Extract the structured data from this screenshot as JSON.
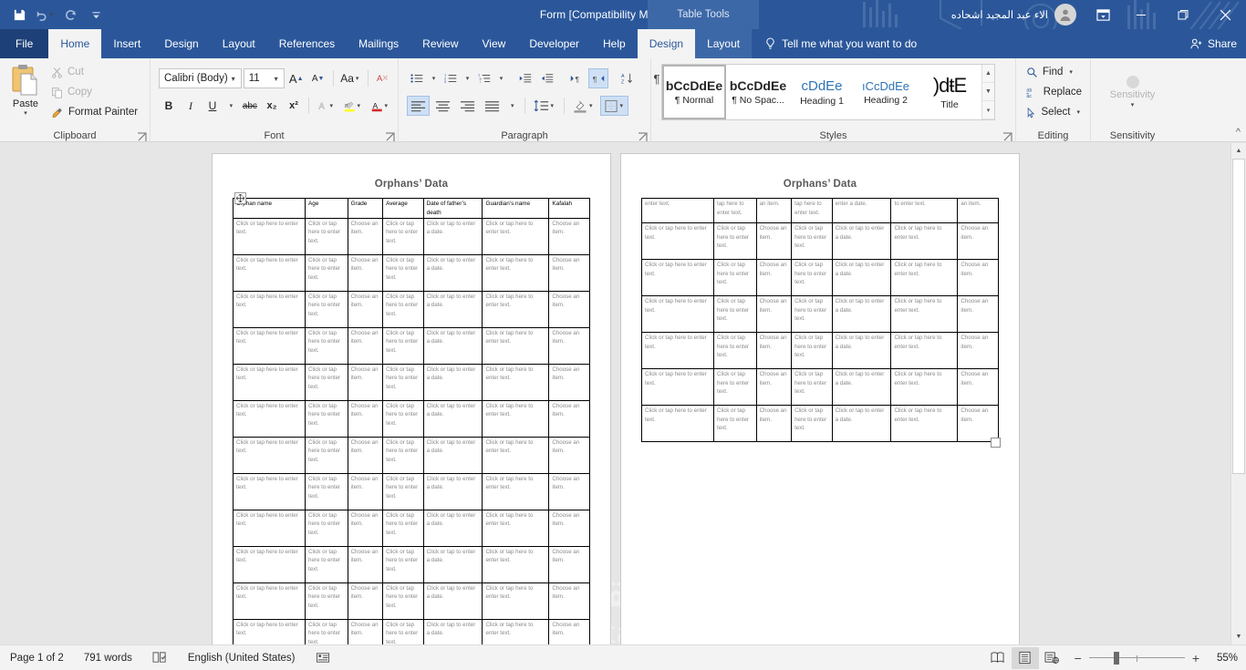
{
  "titlebar": {
    "doc_title": "Form [Compatibility Mode]  -  Word",
    "contextual_tools": "Table Tools",
    "account_name": "الاء عبد المجيد اشحاده",
    "qat": [
      {
        "name": "save-icon",
        "label": "Save"
      },
      {
        "name": "undo-icon",
        "label": "Undo"
      },
      {
        "name": "redo-icon",
        "label": "Redo"
      },
      {
        "name": "customize-qat-icon",
        "label": "Customize Quick Access Toolbar"
      }
    ],
    "window_buttons": [
      {
        "name": "ribbon-display-options-button",
        "label": "Ribbon Display Options"
      },
      {
        "name": "minimize-button",
        "label": "Minimize"
      },
      {
        "name": "restore-button",
        "label": "Restore Down"
      },
      {
        "name": "close-button",
        "label": "Close"
      }
    ]
  },
  "tabs": {
    "file": "File",
    "items": [
      "Home",
      "Insert",
      "Design",
      "Layout",
      "References",
      "Mailings",
      "Review",
      "View",
      "Developer",
      "Help"
    ],
    "active": "Home",
    "table_tools": [
      "Design",
      "Layout"
    ],
    "table_tools_active": "Design",
    "tellme": "Tell me what you want to do",
    "share": "Share"
  },
  "ribbon": {
    "clipboard": {
      "group_label": "Clipboard",
      "paste": "Paste",
      "cut": "Cut",
      "copy": "Copy",
      "format_painter": "Format Painter"
    },
    "font": {
      "group_label": "Font",
      "font_name": "Calibri (Body)",
      "font_size": "11",
      "grow_font": "A",
      "shrink_font": "A",
      "change_case": "Aa",
      "clear_formatting": "Clear All Formatting",
      "bold": "B",
      "italic": "I",
      "underline": "U",
      "strikethrough": "abc",
      "subscript": "x₂",
      "superscript": "x²",
      "text_effects": "A",
      "highlight": "ab",
      "font_color": "A"
    },
    "paragraph": {
      "group_label": "Paragraph"
    },
    "styles": {
      "group_label": "Styles",
      "items": [
        {
          "preview": "bCcDdEe",
          "name": "¶ Normal",
          "kind": "norm",
          "selected": true
        },
        {
          "preview": "bCcDdEe",
          "name": "¶ No Spac...",
          "kind": "norm",
          "selected": false
        },
        {
          "preview": "cDdEe",
          "name": "Heading 1",
          "kind": "h1",
          "selected": false
        },
        {
          "preview": "ıCcDdEe",
          "name": "Heading 2",
          "kind": "h2",
          "selected": false
        },
        {
          "preview": ")dŧE",
          "name": "Title",
          "kind": "title",
          "selected": false
        }
      ]
    },
    "editing": {
      "group_label": "Editing",
      "find": "Find",
      "replace": "Replace",
      "select": "Select"
    },
    "sensitivity": {
      "group_label": "Sensitivity",
      "button": "Sensitivity"
    }
  },
  "document": {
    "page_title": "Orphans’ Data",
    "columns": [
      "Orphan name",
      "Age",
      "Grade",
      "Average",
      "Date of father’s death",
      "Guardian’s name",
      "Kafalah"
    ],
    "cell_placeholders": {
      "name": "Click or tap here to enter text.",
      "age": "Click or tap here to enter text.",
      "grade": "Choose an item.",
      "average": "Click or tap here to enter text.",
      "date_of_death": "Click or tap to enter a date.",
      "guardian": "Click or tap here to enter text.",
      "kafalah": "Choose an item."
    },
    "page2_continuation": {
      "name": "enter text.",
      "age": "tap here to enter text.",
      "grade": "an item.",
      "average": "tap here to enter text.",
      "date_of_death": "enter a date.",
      "guardian": "to enter text.",
      "kafalah": "an item."
    },
    "page1_row_count": 12,
    "page2_row_count": 6,
    "watermark_ar": "مستقل",
    "watermark_en": "mostaql.com"
  },
  "statusbar": {
    "page": "Page 1 of 2",
    "words": "791 words",
    "proofing_icon": "proofing-errors-icon",
    "language": "English (United States)",
    "macro_icon": "macro-recording-icon",
    "views": [
      {
        "name": "read-mode-button",
        "active": false
      },
      {
        "name": "print-layout-button",
        "active": true
      },
      {
        "name": "web-layout-button",
        "active": false
      }
    ],
    "zoom_out": "−",
    "zoom_in": "+",
    "zoom_level": "55%"
  }
}
